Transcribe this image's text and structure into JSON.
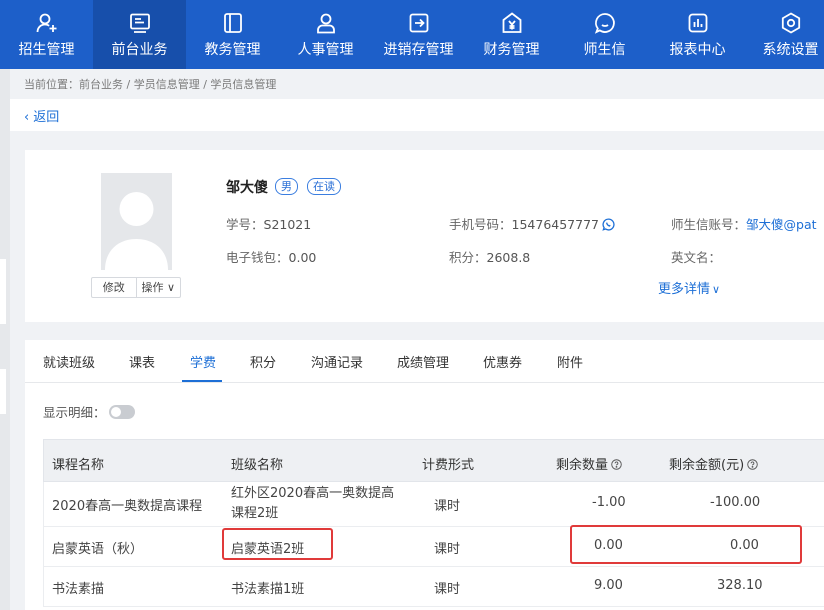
{
  "nav": {
    "items": [
      {
        "label": "招生管理",
        "icon": "user-plus-icon"
      },
      {
        "label": "前台业务",
        "icon": "monitor-icon"
      },
      {
        "label": "教务管理",
        "icon": "book-icon"
      },
      {
        "label": "人事管理",
        "icon": "person-icon"
      },
      {
        "label": "进销存管理",
        "icon": "inventory-icon"
      },
      {
        "label": "财务管理",
        "icon": "finance-icon"
      },
      {
        "label": "师生信",
        "icon": "chat-icon"
      },
      {
        "label": "报表中心",
        "icon": "report-icon"
      },
      {
        "label": "系统设置",
        "icon": "gear-icon"
      }
    ],
    "active_index": 1,
    "colors": {
      "bar": "#1d5fc9",
      "active": "#174fab"
    }
  },
  "breadcrumb": "当前位置：前台业务 / 学员信息管理 / 学员信息管理",
  "back_label": "返回",
  "student": {
    "name": "邹大傻",
    "gender": "男",
    "status": "在读",
    "avatar_actions": {
      "edit": "修改",
      "ops": "操作"
    },
    "fields": {
      "student_no_label": "学号：",
      "student_no": "S21021",
      "phone_label": "手机号码：",
      "phone": "15476457777",
      "account_label": "师生信账号：",
      "account": "邹大傻@pat",
      "wallet_label": "电子钱包：",
      "wallet": "0.00",
      "points_label": "积分：",
      "points": "2608.8",
      "english_label": "英文名：",
      "english": ""
    },
    "more_details": "更多详情"
  },
  "tabs": {
    "items": [
      "就读班级",
      "课表",
      "学费",
      "积分",
      "沟通记录",
      "成绩管理",
      "优惠券",
      "附件"
    ],
    "active": "学费"
  },
  "show_detail_label": "显示明细：",
  "show_detail_on": false,
  "table": {
    "headers": {
      "course": "课程名称",
      "class": "班级名称",
      "billing": "计费形式",
      "remaining_qty": "剩余数量",
      "remaining_amount": "剩余金额(元)"
    },
    "rows": [
      {
        "course": "2020春高一奥数提高课程",
        "class": "红外区2020春高一奥数提高课程2班",
        "billing": "课时",
        "qty": "-1.00",
        "amount": "-100.00"
      },
      {
        "course": "启蒙英语（秋）",
        "class": "启蒙英语2班",
        "billing": "课时",
        "qty": "0.00",
        "amount": "0.00"
      },
      {
        "course": "书法素描",
        "class": "书法素描1班",
        "billing": "课时",
        "qty": "9.00",
        "amount": "328.10"
      }
    ]
  },
  "highlight_color": "#e03a3a",
  "accent_color": "#1d6fd6"
}
